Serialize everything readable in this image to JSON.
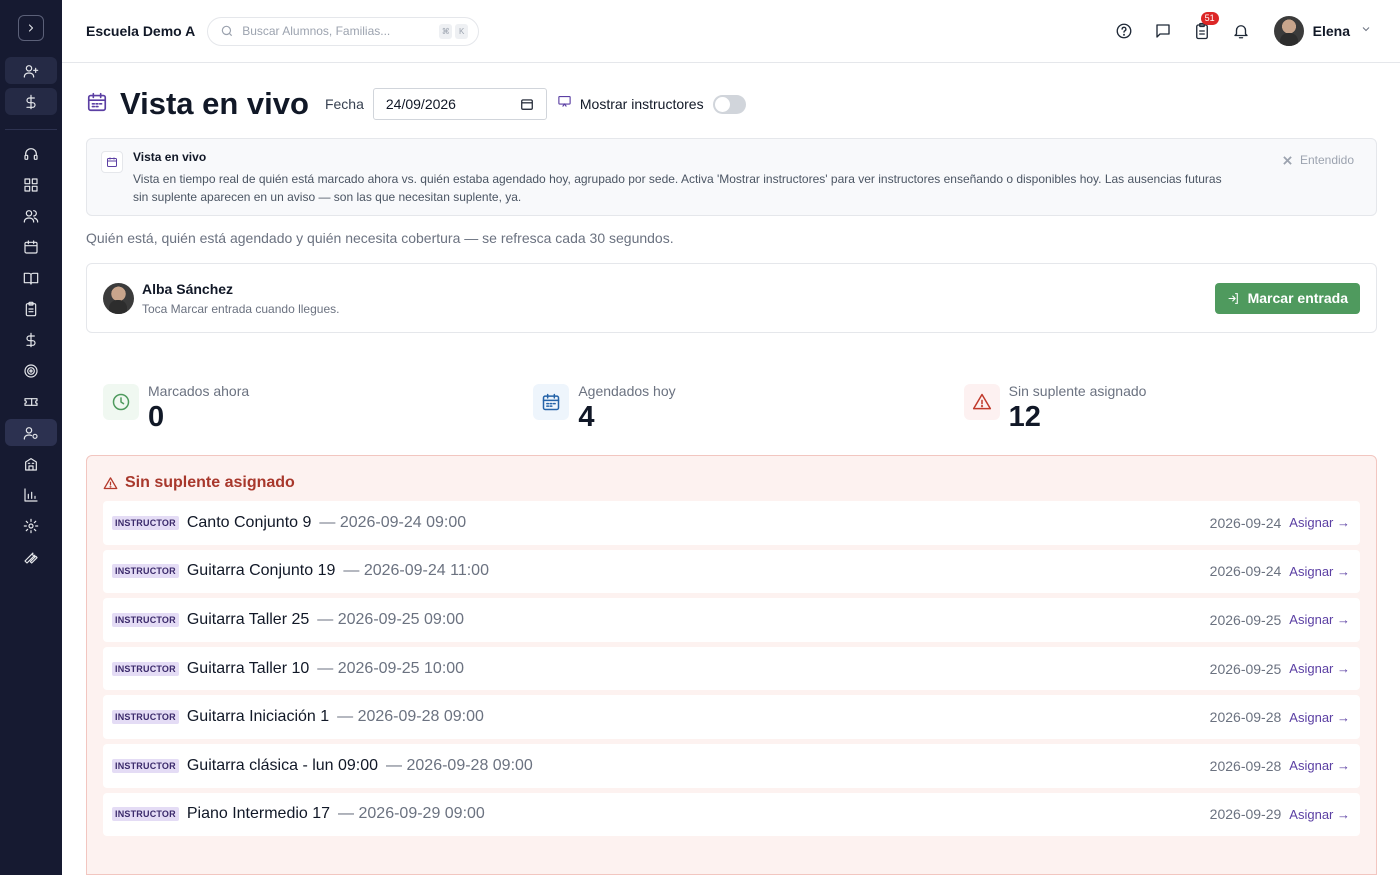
{
  "header": {
    "school_name": "Escuela Demo A",
    "search_placeholder": "Buscar Alumnos, Familias...",
    "shortcut_keys": [
      "⌘",
      "K"
    ],
    "notification_count": "51",
    "user_name": "Elena"
  },
  "page": {
    "title": "Vista en vivo",
    "date_label": "Fecha",
    "date_value": "24/09/2026",
    "toggle_label": "Mostrar instructores",
    "toggle_on": false
  },
  "info_banner": {
    "title": "Vista en vivo",
    "text": "Vista en tiempo real de quién está marcado ahora vs. quién estaba agendado hoy, agrupado por sede. Activa 'Mostrar instructores' para ver instructores enseñando o disponibles hoy. Las ausencias futuras sin suplente aparecen en un aviso — son las que necesitan suplente, ya.",
    "dismiss_label": "Entendido"
  },
  "subtitle": "Quién está, quién está agendado y quién necesita cobertura — se refresca cada 30 segundos.",
  "checkin": {
    "name": "Alba Sánchez",
    "hint": "Toca Marcar entrada cuando llegues.",
    "button_label": "Marcar entrada"
  },
  "stats": [
    {
      "label": "Marcados ahora",
      "value": "0",
      "icon": "clock-icon",
      "color": "#4f9a5e"
    },
    {
      "label": "Agendados hoy",
      "value": "4",
      "icon": "calendar-icon",
      "color": "#2563a8"
    },
    {
      "label": "Sin suplente asignado",
      "value": "12",
      "icon": "warning-icon",
      "color": "#c0392b"
    }
  ],
  "alert": {
    "title": "Sin suplente asignado",
    "tag": "INSTRUCTOR",
    "link_label": "Asignar →",
    "rows": [
      {
        "name": "Canto Conjunto 9",
        "when": "— 2026-09-24 09:00",
        "date": "2026-09-24"
      },
      {
        "name": "Guitarra Conjunto 19",
        "when": "— 2026-09-24 11:00",
        "date": "2026-09-24"
      },
      {
        "name": "Guitarra Taller 25",
        "when": "— 2026-09-25 09:00",
        "date": "2026-09-25"
      },
      {
        "name": "Guitarra Taller 10",
        "when": "— 2026-09-25 10:00",
        "date": "2026-09-25"
      },
      {
        "name": "Guitarra Iniciación 1",
        "when": "— 2026-09-28 09:00",
        "date": "2026-09-28"
      },
      {
        "name": "Guitarra clásica - lun 09:00",
        "when": "— 2026-09-28 09:00",
        "date": "2026-09-28"
      },
      {
        "name": "Piano Intermedio 17",
        "when": "— 2026-09-29 09:00",
        "date": "2026-09-29"
      }
    ]
  },
  "colors": {
    "sidebar_bg": "#161a31",
    "accent": "#5b3fa3",
    "success": "#4f9a5e",
    "danger": "#a8382c"
  }
}
